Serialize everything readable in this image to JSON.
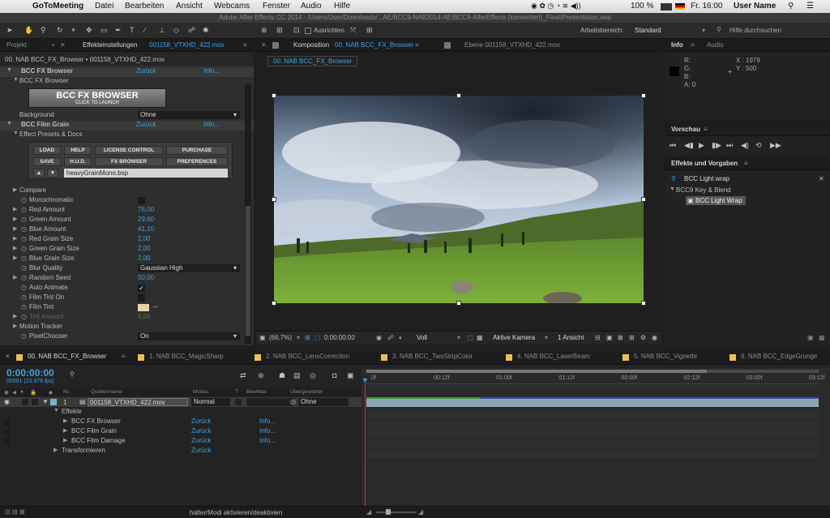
{
  "menubar": {
    "apple": "",
    "app": "GoToMeeting",
    "items": [
      "Datei",
      "Bearbeiten",
      "Ansicht",
      "Webcams",
      "Fenster",
      "Audio",
      "Hilfe"
    ],
    "battery": "100 %",
    "clock": "Fr. 16:00",
    "user": "User Name"
  },
  "window_title": "Adobe After Effects CC 2014 - /Users/User/Downloads/...AE/BCC9-NAB2014-AE/BCC9-AfterEffects (konvertiert)_Final/Presentation.aep",
  "toolbar": {
    "align_label": "Ausrichten",
    "workspace_label": "Arbeitsbereich:",
    "workspace_value": "Standard",
    "help_placeholder": "Hilfe durchsuchen"
  },
  "left_panel": {
    "tab_project": "Projekt",
    "tab_effects": "Effekteinstellungen",
    "tab_effects_file": "001158_VTXHD_422.mov",
    "breadcrumb": "00. NAB BCC_FX_Browser • 001158_VTXHD_422.mov",
    "bcc_fx_browser": {
      "name": "BCC FX Browser",
      "reset": "Zurück",
      "info": "Info...",
      "sub": "BCC FX Browser",
      "btn_title": "BCC FX BROWSER",
      "btn_sub": "CLICK TO LAUNCH",
      "bg_label": "Background",
      "bg_value": "Ohne"
    },
    "film_grain": {
      "name": "BCC Film Grain",
      "reset": "Zurück",
      "info": "Info...",
      "presets": "Effect Presets & Docs",
      "buttons": [
        "LOAD",
        "HELP",
        "LICENSE CONTROL",
        "PURCHASE",
        "SAVE",
        "H.U.D.",
        "FX BROWSER",
        "PREFERENCES"
      ],
      "preset_file": "heavyGrainMono.bsp"
    },
    "params": [
      {
        "label": "Compare",
        "value": "",
        "kind": "group"
      },
      {
        "label": "Monochromatic",
        "value": "",
        "kind": "check"
      },
      {
        "label": "Red Amount",
        "value": "76,00",
        "kind": "num"
      },
      {
        "label": "Green Amount",
        "value": "29,60",
        "kind": "num"
      },
      {
        "label": "Blue Amount",
        "value": "41,10",
        "kind": "num"
      },
      {
        "label": "Red Grain Size",
        "value": "2,00",
        "kind": "num"
      },
      {
        "label": "Green Grain Size",
        "value": "2,00",
        "kind": "num"
      },
      {
        "label": "Blue Grain Size",
        "value": "2,00",
        "kind": "num"
      },
      {
        "label": "Blur Quality",
        "value": "Gaussian High",
        "kind": "dropdown"
      },
      {
        "label": "Random Seed",
        "value": "50,00",
        "kind": "num"
      },
      {
        "label": "Auto Animate",
        "value": "✓",
        "kind": "check"
      },
      {
        "label": "Film Tint On",
        "value": "",
        "kind": "check"
      },
      {
        "label": "Film Tint",
        "value": "",
        "kind": "color"
      },
      {
        "label": "Tint Amount",
        "value": "5,00",
        "kind": "dim"
      },
      {
        "label": "Motion Tracker",
        "value": "",
        "kind": "group"
      },
      {
        "label": "PixelChooser",
        "value": "On",
        "kind": "dropdown"
      }
    ]
  },
  "comp_panel": {
    "tab_comp": "Komposition",
    "tab_comp_name": "00. NAB BCC_FX_Browser",
    "tab_layer": "Ebene 001158_VTXHD_422.mov",
    "comp_label": "00. NAB BCC_FX_Browser",
    "zoom": "(66,7%)",
    "timecode": "0:00:00:00",
    "resolution": "Voll",
    "camera": "Aktive Kamera",
    "views": "1 Ansicht"
  },
  "info_panel": {
    "tab_info": "Info",
    "tab_audio": "Audio",
    "r": "R:",
    "g": "G:",
    "b": "B:",
    "a": "A:  0",
    "x": "X : 1979",
    "y": "Y : 500"
  },
  "preview_panel": {
    "title": "Vorschau"
  },
  "effects_panel": {
    "title": "Effekte und Vorgaben",
    "search": "BCC Light wrap",
    "category": "BCC9 Key & Blend",
    "item": "BCC Light Wrap"
  },
  "timeline": {
    "tabs": [
      "00. NAB BCC_FX_Browser",
      "1. NAB BCC_MagicSharp",
      "2. NAB BCC_LensCorrection",
      "3. NAB BCC_TwoStripColor",
      "4. NAB BCC_LaserBeam",
      "5. NAB BCC_Vignette",
      "6. NAB BCC_EdgeGrunge"
    ],
    "timecode": "0:00:00:00",
    "fps": "00001 (23.976 fps)",
    "col_nr": "Nr.",
    "col_source": "Quellenname",
    "col_mode": "Modus",
    "col_t": "T",
    "col_trkmat": "BewMas",
    "col_parent": "Übergeordnet",
    "layer_num": "1",
    "layer_name": "001158_VTXHD_422.mov",
    "layer_mode": "Normal",
    "layer_parent": "Ohne",
    "effects_label": "Effekte",
    "effects": [
      {
        "name": "BCC FX Browser",
        "reset": "Zurück",
        "info": "Info..."
      },
      {
        "name": "BCC Film Grain",
        "reset": "Zurück",
        "info": "Info..."
      },
      {
        "name": "BCC Film Damage",
        "reset": "Zurück",
        "info": "Info..."
      }
    ],
    "transform": "Transformieren",
    "transform_reset": "Zurück",
    "ruler": [
      "0f",
      "00:12f",
      "01:00f",
      "01:12f",
      "02:00f",
      "02:12f",
      "03:00f",
      "03:12f"
    ],
    "status": "halter/Modi aktivieren/deaktivien"
  }
}
